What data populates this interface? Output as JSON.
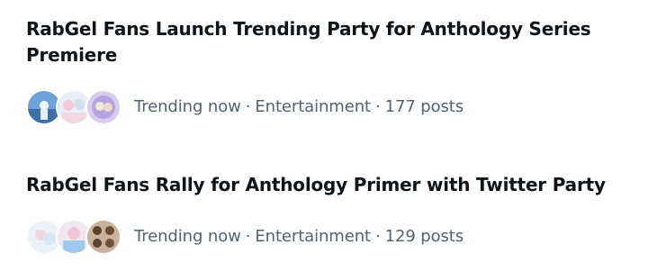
{
  "trends": [
    {
      "title": "RabGel Fans Launch Trending Party for Anthology Series Premiere",
      "status": "Trending now",
      "category": "Entertainment",
      "posts": "177 posts",
      "separator": "·"
    },
    {
      "title": "RabGel Fans Rally for Anthology Primer with Twitter Party",
      "status": "Trending now",
      "category": "Entertainment",
      "posts": "129 posts",
      "separator": "·"
    }
  ],
  "colors": {
    "title": "#0f1419",
    "meta": "#536471",
    "background": "#ffffff"
  }
}
